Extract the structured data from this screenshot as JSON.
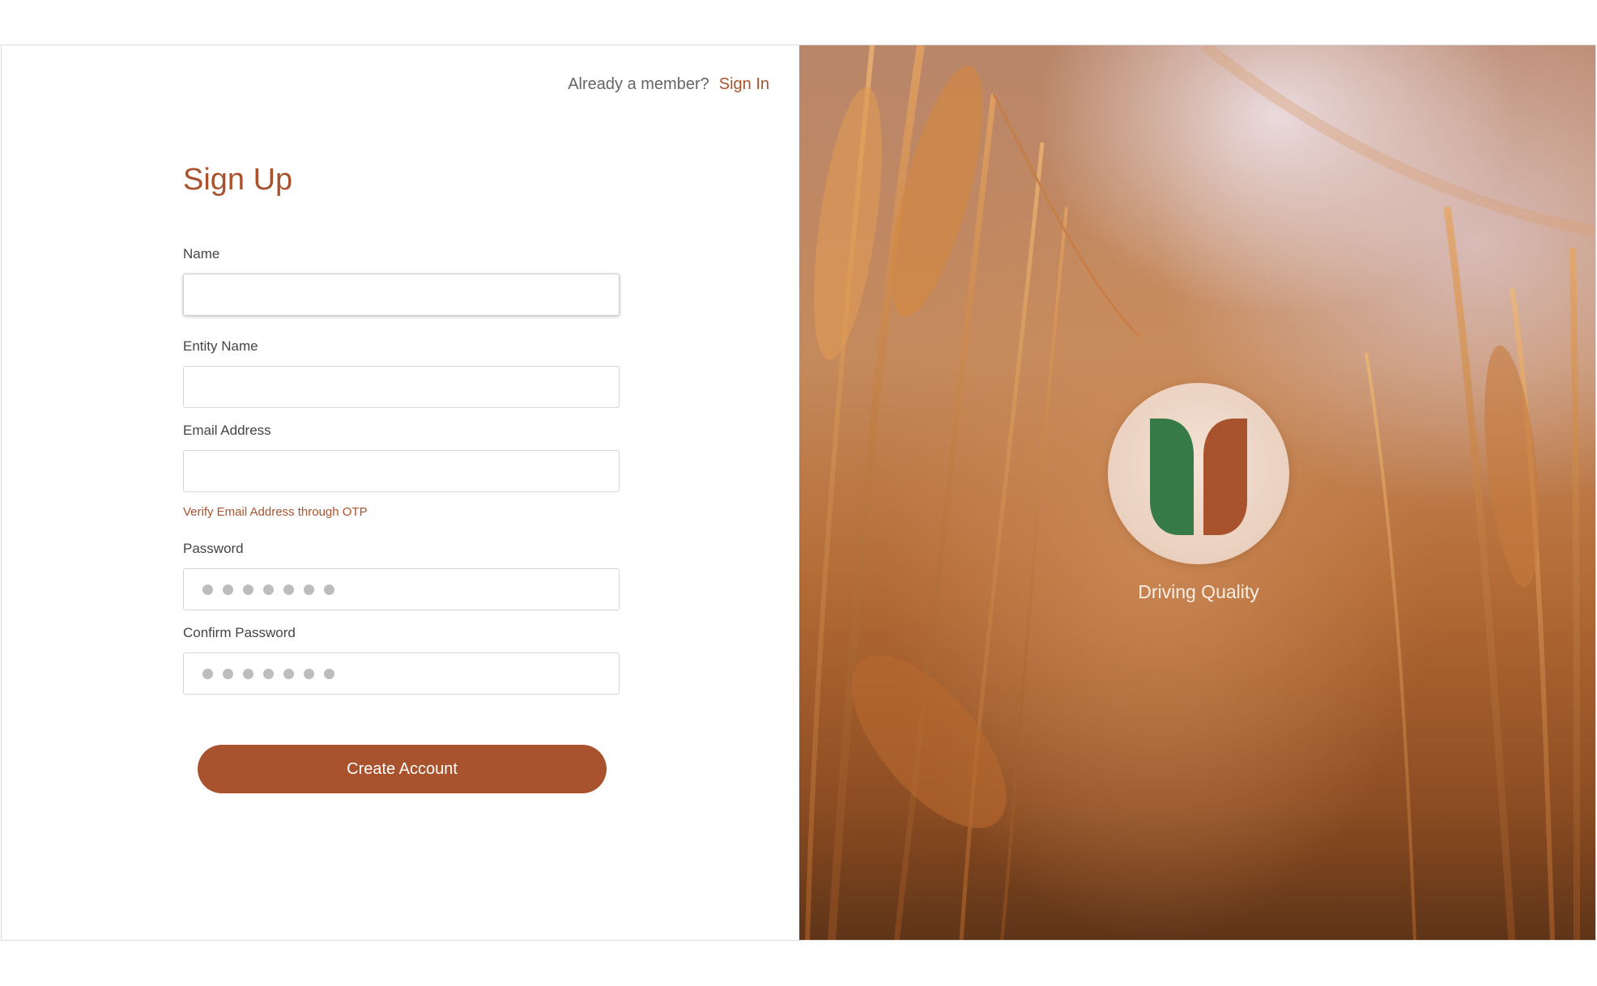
{
  "header": {
    "member_prompt": "Already a member?",
    "signin_label": "Sign In"
  },
  "form": {
    "title": "Sign Up",
    "fields": [
      {
        "label": "Name",
        "value": "",
        "placeholder": ""
      },
      {
        "label": "Entity Name",
        "value": "",
        "placeholder": ""
      },
      {
        "label": "Email Address",
        "value": "",
        "placeholder": ""
      },
      {
        "label": "Password",
        "value": "•••••••",
        "masked": true
      },
      {
        "label": "Confirm Password",
        "value": "•••••••",
        "masked": true
      }
    ],
    "verify_link": "Verify Email Address through OTP",
    "submit_label": "Create Account"
  },
  "brand": {
    "tagline": "Driving Quality",
    "logo_left_color": "#367a48",
    "logo_right_color": "#a9532e",
    "accent_color": "#a9532e"
  }
}
